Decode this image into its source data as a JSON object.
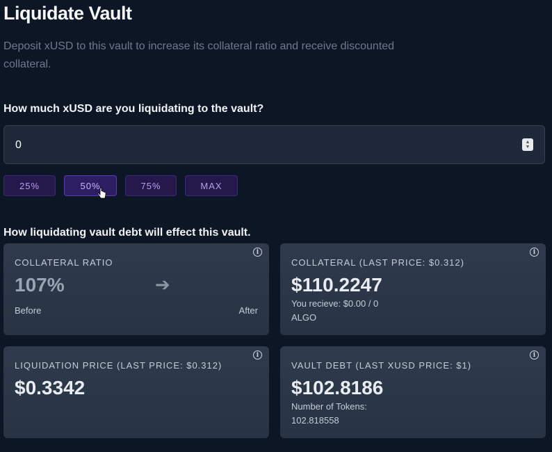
{
  "header": {
    "title": "Liquidate Vault",
    "subtitle": "Deposit xUSD to this vault to increase its collateral ratio and receive discounted collateral."
  },
  "liquidate_form": {
    "question": "How much xUSD are you liquidating to the vault?",
    "amount_value": "0",
    "percent_buttons": [
      "25%",
      "50%",
      "75%",
      "MAX"
    ]
  },
  "effects": {
    "heading": "How liquidating vault debt will effect this vault.",
    "collateral_ratio": {
      "label": "COLLATERAL RATIO",
      "before_value": "107%",
      "before_label": "Before",
      "after_label": "After"
    },
    "collateral": {
      "label": "COLLATERAL (LAST PRICE: $0.312)",
      "value": "$110.2247",
      "receive_line": "You recieve: $0.00 / 0",
      "asset": "ALGO"
    },
    "liquidation_price": {
      "label": "LIQUIDATION PRICE (LAST PRICE: $0.312)",
      "value": "$0.3342"
    },
    "vault_debt": {
      "label": "VAULT DEBT (LAST XUSD PRICE: $1)",
      "value": "$102.8186",
      "tokens_label": "Number of Tokens:",
      "tokens_value": "102.818558"
    }
  },
  "icons": {
    "info": "info-icon",
    "arrow": "arrow-right-icon",
    "cursor": "hand-pointer-icon"
  },
  "colors": {
    "background": "#0d1624",
    "card": "#2f3b4c",
    "accent": "#b89ef0"
  }
}
